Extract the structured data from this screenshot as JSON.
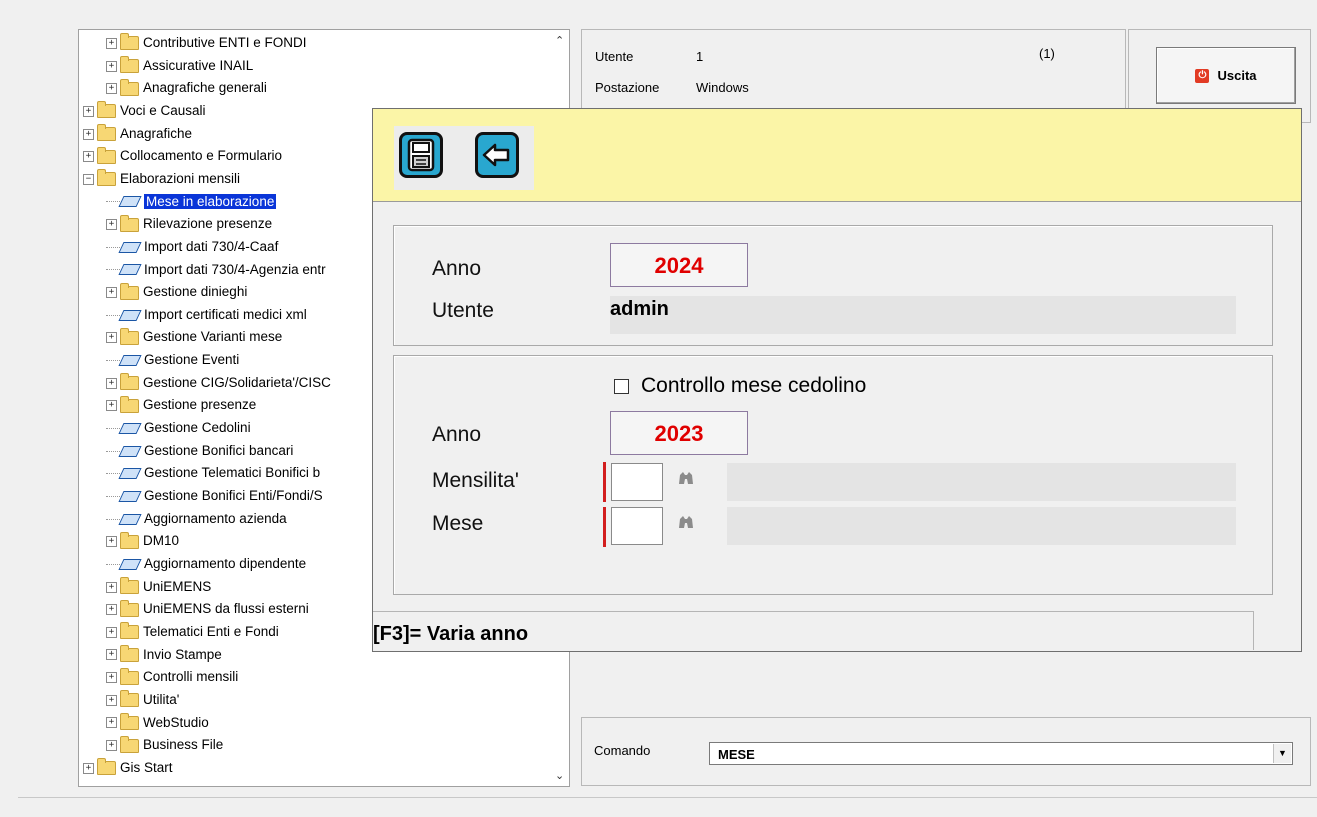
{
  "tree": {
    "items": [
      {
        "label": "Contributive ENTI e FONDI",
        "type": "folder",
        "level": 1
      },
      {
        "label": "Assicurative INAIL",
        "type": "folder",
        "level": 1
      },
      {
        "label": "Anagrafiche generali",
        "type": "folder",
        "level": 1
      },
      {
        "label": "Voci e Causali",
        "type": "folder",
        "level": 0
      },
      {
        "label": "Anagrafiche",
        "type": "folder",
        "level": 0
      },
      {
        "label": "Collocamento e Formulario",
        "type": "folder",
        "level": 0
      },
      {
        "label": "Elaborazioni mensili",
        "type": "folder-open",
        "level": 0
      },
      {
        "label": "Mese in elaborazione",
        "type": "leaf",
        "level": 1,
        "selected": true
      },
      {
        "label": "Rilevazione presenze",
        "type": "folder",
        "level": 1
      },
      {
        "label": "Import dati 730/4-Caaf",
        "type": "leaf",
        "level": 1
      },
      {
        "label": "Import dati 730/4-Agenzia entr",
        "type": "leaf",
        "level": 1
      },
      {
        "label": "Gestione dinieghi",
        "type": "folder",
        "level": 1
      },
      {
        "label": "Import certificati medici xml",
        "type": "leaf",
        "level": 1
      },
      {
        "label": "Gestione Varianti mese",
        "type": "folder",
        "level": 1
      },
      {
        "label": "Gestione Eventi",
        "type": "leaf",
        "level": 1
      },
      {
        "label": "Gestione CIG/Solidarieta'/CISC",
        "type": "folder",
        "level": 1
      },
      {
        "label": "Gestione presenze",
        "type": "folder",
        "level": 1
      },
      {
        "label": "Gestione Cedolini",
        "type": "leaf",
        "level": 1
      },
      {
        "label": "Gestione Bonifici bancari",
        "type": "leaf",
        "level": 1
      },
      {
        "label": "Gestione Telematici Bonifici b",
        "type": "leaf",
        "level": 1
      },
      {
        "label": "Gestione Bonifici Enti/Fondi/S",
        "type": "leaf",
        "level": 1
      },
      {
        "label": "Aggiornamento azienda",
        "type": "leaf",
        "level": 1
      },
      {
        "label": "DM10",
        "type": "folder",
        "level": 1
      },
      {
        "label": "Aggiornamento dipendente",
        "type": "leaf",
        "level": 1
      },
      {
        "label": "UniEMENS",
        "type": "folder",
        "level": 1
      },
      {
        "label": "UniEMENS da flussi esterni",
        "type": "folder",
        "level": 1
      },
      {
        "label": "Telematici Enti e Fondi",
        "type": "folder",
        "level": 1
      },
      {
        "label": "Invio Stampe",
        "type": "folder",
        "level": 1
      },
      {
        "label": "Controlli mensili",
        "type": "folder",
        "level": 1
      },
      {
        "label": "Utilita'",
        "type": "folder",
        "level": 1
      },
      {
        "label": "WebStudio",
        "type": "folder",
        "level": 1
      },
      {
        "label": "Business File",
        "type": "folder",
        "level": 1
      },
      {
        "label": "Gis Start",
        "type": "folder",
        "level": 0
      }
    ]
  },
  "user_panel": {
    "utente_label": "Utente",
    "utente_value": "1",
    "utente_code": "(1)",
    "postazione_label": "Postazione",
    "postazione_value": "Windows"
  },
  "exit_button": {
    "label": "Uscita"
  },
  "command": {
    "label": "Comando",
    "value": "MESE"
  },
  "dialog": {
    "toolbar": {
      "save_icon": "save-icon",
      "back_icon": "back-icon"
    },
    "section1": {
      "anno_label": "Anno",
      "anno_value": "2024",
      "utente_label": "Utente",
      "utente_value": "admin"
    },
    "section2": {
      "checkbox_label": "Controllo mese cedolino",
      "checkbox_checked": false,
      "anno_label": "Anno",
      "anno_value": "2023",
      "mensilita_label": "Mensilita'",
      "mensilita_value": "",
      "mese_label": "Mese",
      "mese_value": ""
    },
    "hint": "[F3]= Varia anno"
  },
  "colors": {
    "toolbar_bg": "#fbf5a7",
    "year_text": "#e00000",
    "selection": "#0a35d8",
    "required_marker": "#d21e1e"
  }
}
